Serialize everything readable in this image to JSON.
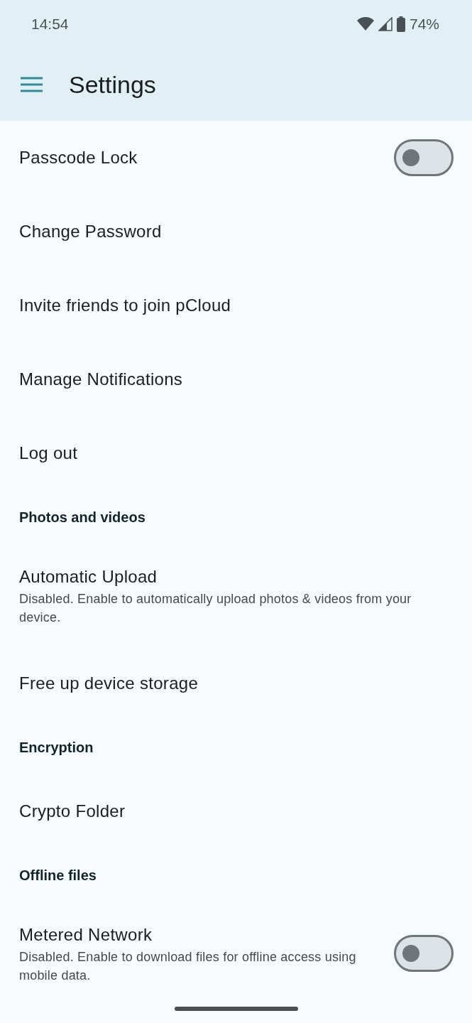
{
  "status_bar": {
    "time": "14:54",
    "battery": "74%"
  },
  "app_bar": {
    "title": "Settings"
  },
  "items": [
    {
      "kind": "switch",
      "title": "Passcode Lock",
      "on": false
    },
    {
      "kind": "plain",
      "title": "Change Password"
    },
    {
      "kind": "plain",
      "title": "Invite friends to join pCloud"
    },
    {
      "kind": "plain",
      "title": "Manage Notifications"
    },
    {
      "kind": "plain",
      "title": "Log out"
    },
    {
      "kind": "header",
      "title": "Photos and videos"
    },
    {
      "kind": "plain",
      "title": "Automatic Upload",
      "subtitle": "Disabled. Enable to automatically upload photos & videos from your device."
    },
    {
      "kind": "plain",
      "title": "Free up device storage"
    },
    {
      "kind": "header",
      "title": "Encryption"
    },
    {
      "kind": "plain",
      "title": "Crypto Folder"
    },
    {
      "kind": "header",
      "title": "Offline files"
    },
    {
      "kind": "switch",
      "title": "Metered Network",
      "subtitle": "Disabled. Enable to download files for offline access using mobile data.",
      "on": false
    }
  ]
}
